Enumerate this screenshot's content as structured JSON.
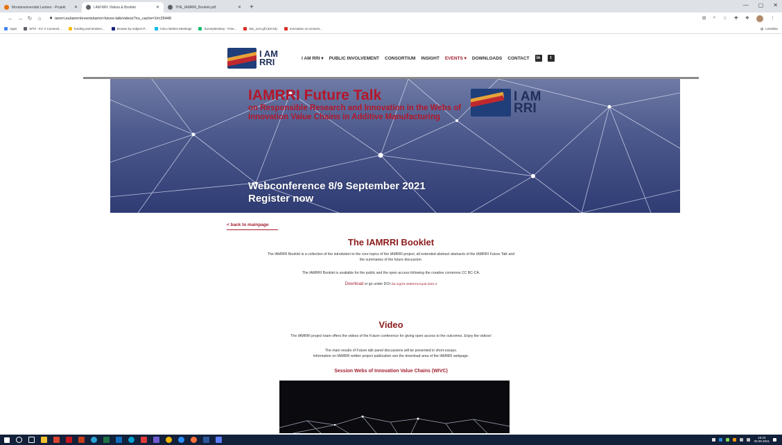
{
  "browser": {
    "tabs": [
      {
        "title": "Montanuniversität Leoben - Projekt",
        "favicon_color": "#e8710a"
      },
      {
        "title": "I AM RRI: Videos & Booklet",
        "favicon_color": "#5f6368"
      },
      {
        "title": "THE_IAMRRI_Booklet.pdf",
        "favicon_color": "#5f6368"
      }
    ],
    "new_tab": "+",
    "window_controls": [
      "—",
      "▢",
      "✕"
    ],
    "url": "iamrri.eu/iamrri/events/iamrri-future-talk/videos?no_cache=1#c25448",
    "bookmarks": [
      {
        "label": "Apps",
        "color": "#4285f4"
      },
      {
        "label": "WTZ - KV V Connecti...",
        "color": "#5f6368"
      },
      {
        "label": "funding and tenders...",
        "color": "#fbbc05"
      },
      {
        "label": "Browse by subject P...",
        "color": "#1a237e"
      },
      {
        "label": "Cisco Webex Meetings",
        "color": "#00bceb"
      },
      {
        "label": "SurveyMonkey - Free...",
        "color": "#00bf6f"
      },
      {
        "label": "sbx_icon.gif (33×18)",
        "color": "#d93025"
      },
      {
        "label": "Innovation on Univers...",
        "color": "#d93025"
      }
    ],
    "reading_list": "Leseliste"
  },
  "site": {
    "logo_line1": "I AM",
    "logo_line2": "RRI",
    "menu": [
      {
        "label": "I AM RRI ▾",
        "active": false
      },
      {
        "label": "PUBLIC INVOLVEMENT",
        "active": false
      },
      {
        "label": "CONSORTIUM",
        "active": false
      },
      {
        "label": "INSIGHT",
        "active": false
      },
      {
        "label": "EVENTS ▾",
        "active": true
      },
      {
        "label": "DOWNLOADS",
        "active": false
      },
      {
        "label": "CONTACT",
        "active": false
      }
    ],
    "social": {
      "linkedin": "in",
      "twitter": "t"
    }
  },
  "banner": {
    "title": "IAMRRI Future Talk",
    "subtitle": "on Responsible Research and Innovation in the Webs of Innovation Value Chains in Additive Manufacturing",
    "logo_line1": "I AM",
    "logo_line2": "RRI",
    "conference_line1": "Webconference 8/9 September 2021",
    "conference_line2": "Register now"
  },
  "content": {
    "back_link": "< back to mainpage",
    "booklet_heading": "The IAMRRI Booklet",
    "booklet_p1_line1": "The IAMRRI Booklet is a collection of the introdution to the core topics of the IAMRRI project, all extended abstract abstracts of the IAMRRI Future Talk and",
    "booklet_p1_line2": "the summaries of the future discussion.",
    "booklet_p2": "The IAMRRI Booklet is available for the public and the open access following the creative commons CC BC-CA.",
    "download_label": "Download",
    "doi_prefix": "or go under DOI",
    "doi_link": "doi.org/10.34901/mul.pub.2021.4",
    "video_heading": "Video",
    "video_p1": "The IAMRRI project team offers the videos of the Future conference for giving open access to the outcomes. Enjoy the videos!",
    "video_p2_line1": "The main results of Future talk panel discussions will be presented in short essays.",
    "video_p2_line2": "Information on IAMRRI written project publication see the download area of the IAMRRI webpage.",
    "session_heading": "Session Webs of Innovation Value Chains (WIVC)"
  },
  "taskbar": {
    "time": "16:23",
    "date": "30.09.2021"
  }
}
